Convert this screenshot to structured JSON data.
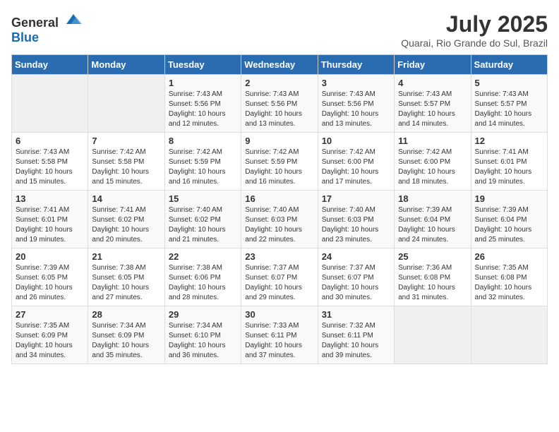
{
  "header": {
    "logo_general": "General",
    "logo_blue": "Blue",
    "month_year": "July 2025",
    "location": "Quarai, Rio Grande do Sul, Brazil"
  },
  "weekdays": [
    "Sunday",
    "Monday",
    "Tuesday",
    "Wednesday",
    "Thursday",
    "Friday",
    "Saturday"
  ],
  "weeks": [
    [
      {
        "day": "",
        "info": ""
      },
      {
        "day": "",
        "info": ""
      },
      {
        "day": "1",
        "info": "Sunrise: 7:43 AM\nSunset: 5:56 PM\nDaylight: 10 hours and 12 minutes."
      },
      {
        "day": "2",
        "info": "Sunrise: 7:43 AM\nSunset: 5:56 PM\nDaylight: 10 hours and 13 minutes."
      },
      {
        "day": "3",
        "info": "Sunrise: 7:43 AM\nSunset: 5:56 PM\nDaylight: 10 hours and 13 minutes."
      },
      {
        "day": "4",
        "info": "Sunrise: 7:43 AM\nSunset: 5:57 PM\nDaylight: 10 hours and 14 minutes."
      },
      {
        "day": "5",
        "info": "Sunrise: 7:43 AM\nSunset: 5:57 PM\nDaylight: 10 hours and 14 minutes."
      }
    ],
    [
      {
        "day": "6",
        "info": "Sunrise: 7:43 AM\nSunset: 5:58 PM\nDaylight: 10 hours and 15 minutes."
      },
      {
        "day": "7",
        "info": "Sunrise: 7:42 AM\nSunset: 5:58 PM\nDaylight: 10 hours and 15 minutes."
      },
      {
        "day": "8",
        "info": "Sunrise: 7:42 AM\nSunset: 5:59 PM\nDaylight: 10 hours and 16 minutes."
      },
      {
        "day": "9",
        "info": "Sunrise: 7:42 AM\nSunset: 5:59 PM\nDaylight: 10 hours and 16 minutes."
      },
      {
        "day": "10",
        "info": "Sunrise: 7:42 AM\nSunset: 6:00 PM\nDaylight: 10 hours and 17 minutes."
      },
      {
        "day": "11",
        "info": "Sunrise: 7:42 AM\nSunset: 6:00 PM\nDaylight: 10 hours and 18 minutes."
      },
      {
        "day": "12",
        "info": "Sunrise: 7:41 AM\nSunset: 6:01 PM\nDaylight: 10 hours and 19 minutes."
      }
    ],
    [
      {
        "day": "13",
        "info": "Sunrise: 7:41 AM\nSunset: 6:01 PM\nDaylight: 10 hours and 19 minutes."
      },
      {
        "day": "14",
        "info": "Sunrise: 7:41 AM\nSunset: 6:02 PM\nDaylight: 10 hours and 20 minutes."
      },
      {
        "day": "15",
        "info": "Sunrise: 7:40 AM\nSunset: 6:02 PM\nDaylight: 10 hours and 21 minutes."
      },
      {
        "day": "16",
        "info": "Sunrise: 7:40 AM\nSunset: 6:03 PM\nDaylight: 10 hours and 22 minutes."
      },
      {
        "day": "17",
        "info": "Sunrise: 7:40 AM\nSunset: 6:03 PM\nDaylight: 10 hours and 23 minutes."
      },
      {
        "day": "18",
        "info": "Sunrise: 7:39 AM\nSunset: 6:04 PM\nDaylight: 10 hours and 24 minutes."
      },
      {
        "day": "19",
        "info": "Sunrise: 7:39 AM\nSunset: 6:04 PM\nDaylight: 10 hours and 25 minutes."
      }
    ],
    [
      {
        "day": "20",
        "info": "Sunrise: 7:39 AM\nSunset: 6:05 PM\nDaylight: 10 hours and 26 minutes."
      },
      {
        "day": "21",
        "info": "Sunrise: 7:38 AM\nSunset: 6:05 PM\nDaylight: 10 hours and 27 minutes."
      },
      {
        "day": "22",
        "info": "Sunrise: 7:38 AM\nSunset: 6:06 PM\nDaylight: 10 hours and 28 minutes."
      },
      {
        "day": "23",
        "info": "Sunrise: 7:37 AM\nSunset: 6:07 PM\nDaylight: 10 hours and 29 minutes."
      },
      {
        "day": "24",
        "info": "Sunrise: 7:37 AM\nSunset: 6:07 PM\nDaylight: 10 hours and 30 minutes."
      },
      {
        "day": "25",
        "info": "Sunrise: 7:36 AM\nSunset: 6:08 PM\nDaylight: 10 hours and 31 minutes."
      },
      {
        "day": "26",
        "info": "Sunrise: 7:35 AM\nSunset: 6:08 PM\nDaylight: 10 hours and 32 minutes."
      }
    ],
    [
      {
        "day": "27",
        "info": "Sunrise: 7:35 AM\nSunset: 6:09 PM\nDaylight: 10 hours and 34 minutes."
      },
      {
        "day": "28",
        "info": "Sunrise: 7:34 AM\nSunset: 6:09 PM\nDaylight: 10 hours and 35 minutes."
      },
      {
        "day": "29",
        "info": "Sunrise: 7:34 AM\nSunset: 6:10 PM\nDaylight: 10 hours and 36 minutes."
      },
      {
        "day": "30",
        "info": "Sunrise: 7:33 AM\nSunset: 6:11 PM\nDaylight: 10 hours and 37 minutes."
      },
      {
        "day": "31",
        "info": "Sunrise: 7:32 AM\nSunset: 6:11 PM\nDaylight: 10 hours and 39 minutes."
      },
      {
        "day": "",
        "info": ""
      },
      {
        "day": "",
        "info": ""
      }
    ]
  ]
}
